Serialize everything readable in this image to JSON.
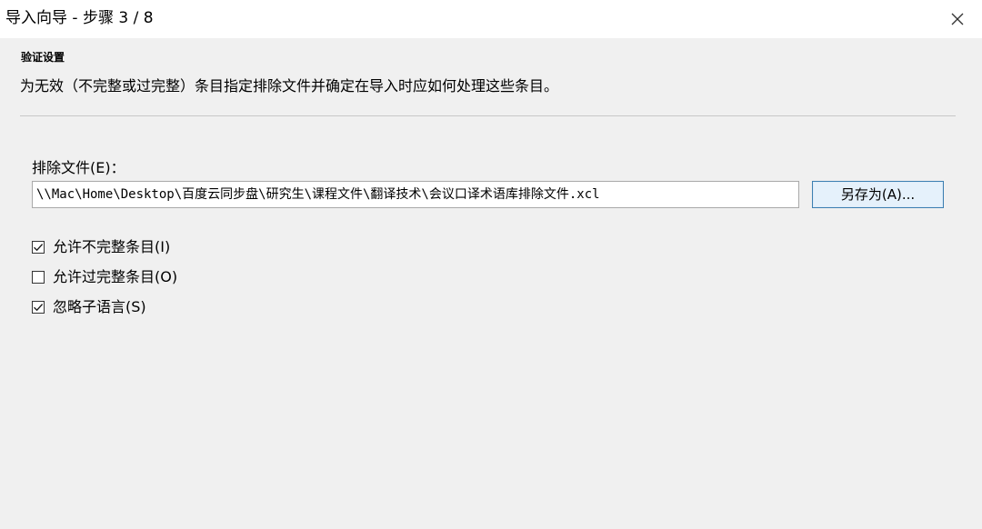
{
  "window": {
    "title": "导入向导 - 步骤 3 / 8",
    "close_icon": "close-icon"
  },
  "header": {
    "section_title": "验证设置",
    "description": "为无效（不完整或过完整）条目指定排除文件并确定在导入时应如何处理这些条目。"
  },
  "exclude_file": {
    "label": "排除文件(E)：",
    "path_value": "\\\\Mac\\Home\\Desktop\\百度云同步盘\\研究生\\课程文件\\翻译技术\\会议口译术语库排除文件.xcl",
    "save_as_label": "另存为(A)..."
  },
  "options": [
    {
      "label": "允许不完整条目(I)",
      "checked": true
    },
    {
      "label": "允许过完整条目(O)",
      "checked": false
    },
    {
      "label": "忽略子语言(S)",
      "checked": true
    }
  ],
  "colors": {
    "background": "#f0f0f0",
    "titlebar": "#ffffff",
    "button_border": "#3c7fb1",
    "button_fill": "#e5f1fb"
  }
}
